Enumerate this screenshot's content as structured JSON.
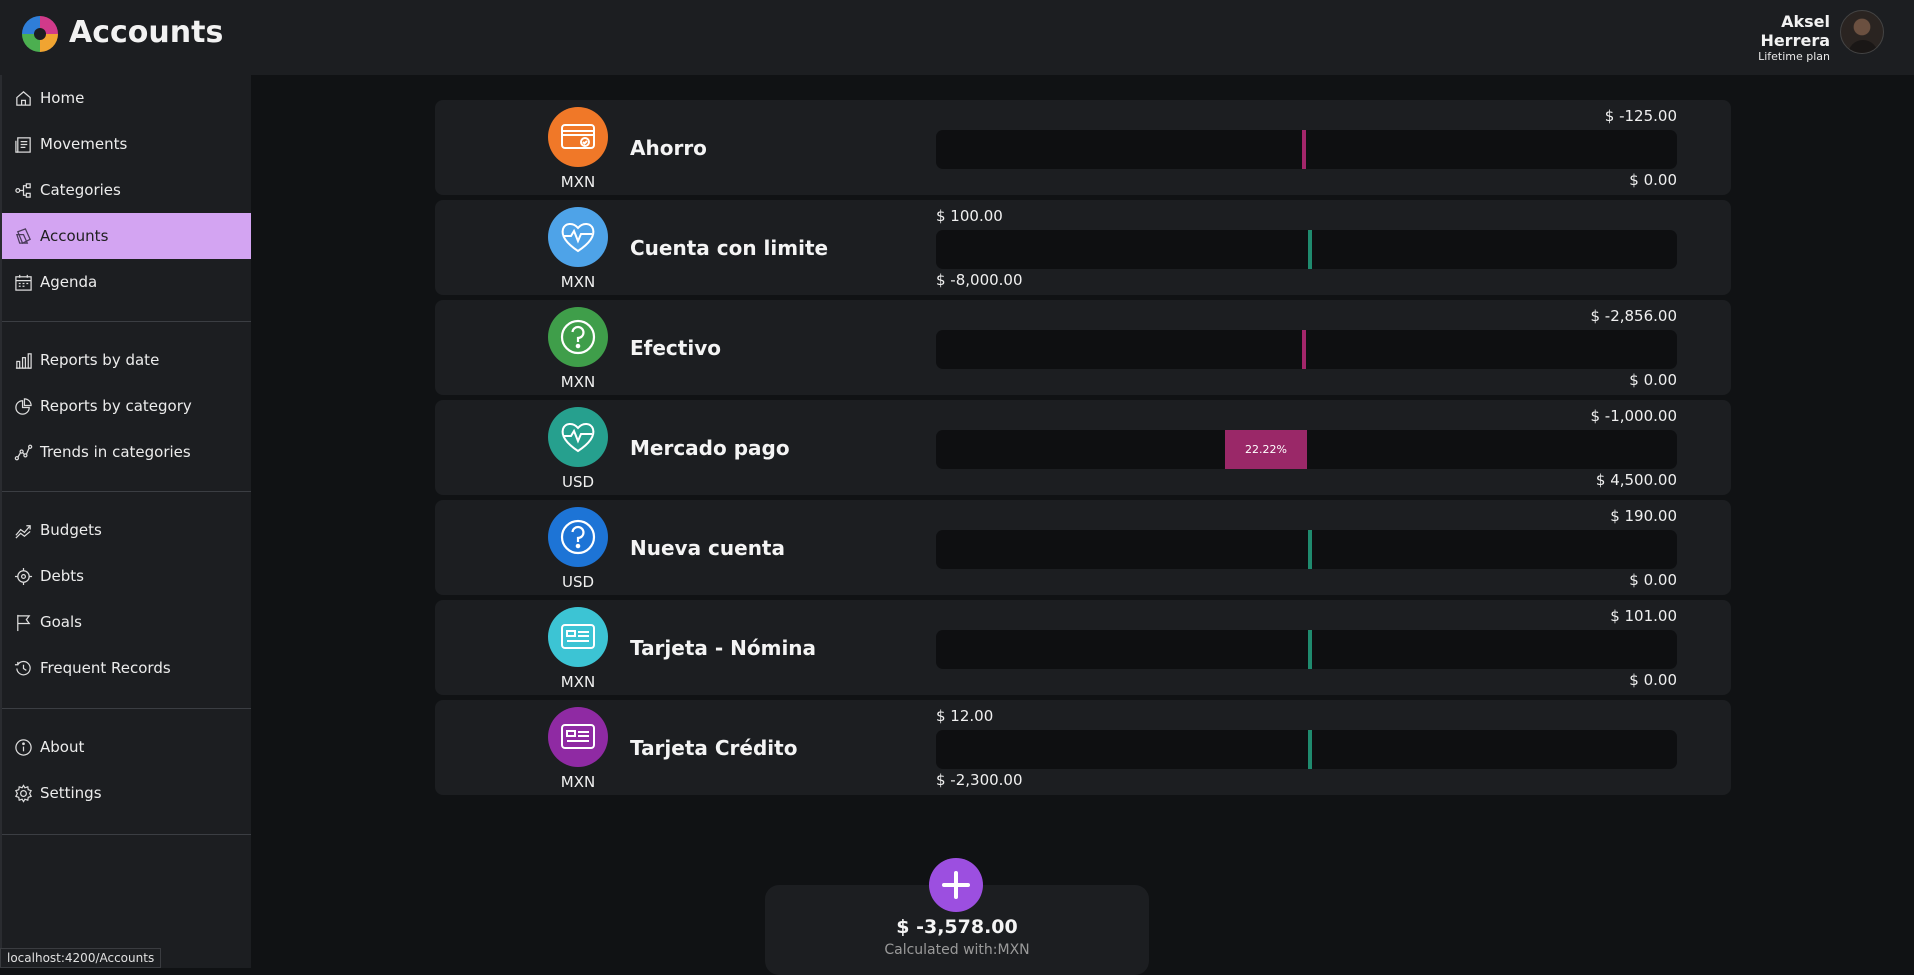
{
  "header": {
    "title": "Accounts",
    "user_first": "Aksel",
    "user_last": "Herrera",
    "plan": "Lifetime plan"
  },
  "sidebar": {
    "items": [
      {
        "label": "Home",
        "icon": "home-icon"
      },
      {
        "label": "Movements",
        "icon": "receipt-icon"
      },
      {
        "label": "Categories",
        "icon": "hierarchy-icon"
      },
      {
        "label": "Accounts",
        "icon": "wallet-icon",
        "active": true
      },
      {
        "label": "Agenda",
        "icon": "calendar-icon"
      },
      {
        "label": "Reports by date",
        "icon": "bar-chart-icon"
      },
      {
        "label": "Reports by category",
        "icon": "pie-chart-icon"
      },
      {
        "label": "Trends in categories",
        "icon": "trend-icon"
      },
      {
        "label": "Budgets",
        "icon": "chart-up-icon"
      },
      {
        "label": "Debts",
        "icon": "target-icon"
      },
      {
        "label": "Goals",
        "icon": "flag-icon"
      },
      {
        "label": "Frequent Records",
        "icon": "history-icon"
      },
      {
        "label": "About",
        "icon": "info-icon"
      },
      {
        "label": "Settings",
        "icon": "gear-icon"
      }
    ]
  },
  "accounts": [
    {
      "name": "Ahorro",
      "currency": "MXN",
      "icon": "card-icon",
      "color": "#f07828",
      "top_right": "$ -125.00",
      "bottom_right": "$ 0.00",
      "top_left": "",
      "bottom_left": "",
      "marker_color": "#a3266a"
    },
    {
      "name": "Cuenta con limite",
      "currency": "MXN",
      "icon": "heart-pulse-icon",
      "color": "#4ea3e8",
      "top_right": "",
      "bottom_right": "",
      "top_left": "$ 100.00",
      "bottom_left": "$ -8,000.00",
      "marker_color": "#1f8a6e"
    },
    {
      "name": "Efectivo",
      "currency": "MXN",
      "icon": "question-icon",
      "color": "#3f9e4a",
      "top_right": "$ -2,856.00",
      "bottom_right": "$ 0.00",
      "top_left": "",
      "bottom_left": "",
      "marker_color": "#a3266a"
    },
    {
      "name": "Mercado pago",
      "currency": "USD",
      "icon": "heart-pulse-icon",
      "color": "#26a08e",
      "top_right": "$ -1,000.00",
      "bottom_right": "$ 4,500.00",
      "top_left": "",
      "bottom_left": "",
      "fill_label": "22.22%",
      "fill_fraction": 0.2222,
      "marker_color": "#a3266a"
    },
    {
      "name": "Nueva cuenta",
      "currency": "USD",
      "icon": "question-icon",
      "color": "#1d74d6",
      "top_right": "$ 190.00",
      "bottom_right": "$ 0.00",
      "top_left": "",
      "bottom_left": "",
      "marker_color": "#1f8a6e"
    },
    {
      "name": "Tarjeta - Nómina",
      "currency": "MXN",
      "icon": "id-card-icon",
      "color": "#3cc4d4",
      "top_right": "$ 101.00",
      "bottom_right": "$ 0.00",
      "top_left": "",
      "bottom_left": "",
      "marker_color": "#1f8a6e"
    },
    {
      "name": "Tarjeta Crédito",
      "currency": "MXN",
      "icon": "id-card-icon",
      "color": "#8f2aa3",
      "top_right": "",
      "bottom_right": "",
      "top_left": "$ 12.00",
      "bottom_left": "$ -2,300.00",
      "marker_color": "#1f8a6e"
    }
  ],
  "summary": {
    "total": "$ -3,578.00",
    "calculated_prefix": "Calculated with:",
    "calculated_currency": "MXN"
  },
  "status": {
    "url": "localhost:4200/Accounts"
  }
}
